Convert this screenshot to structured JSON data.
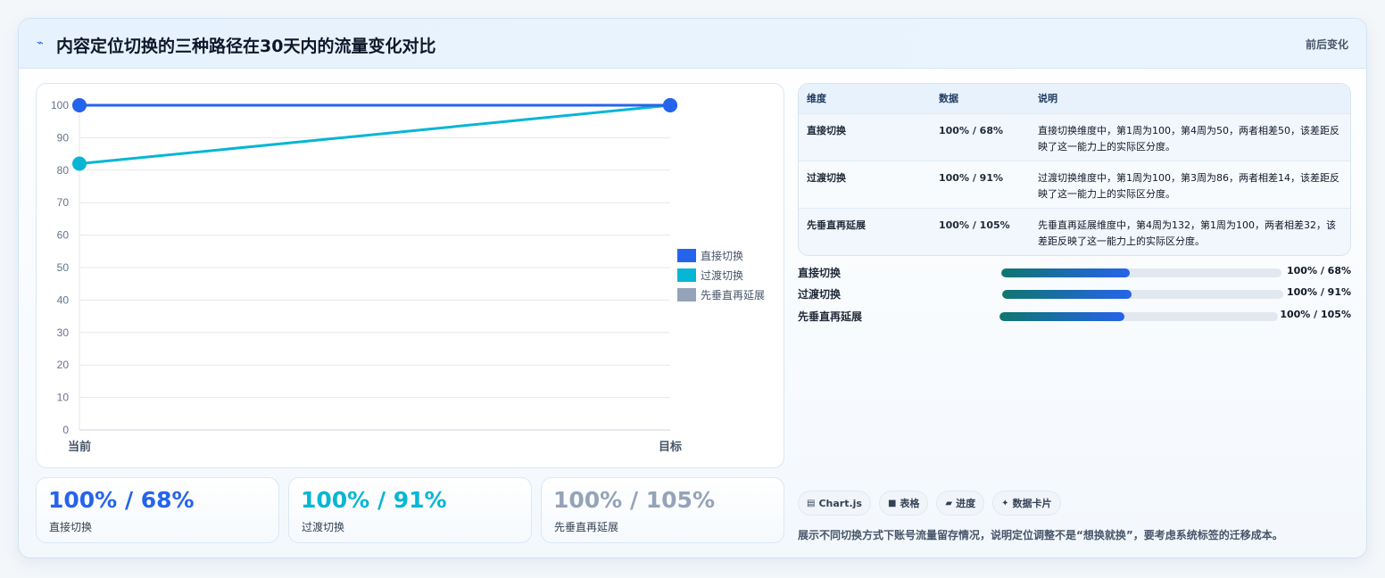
{
  "header": {
    "icon": "lightning-icon",
    "title": "内容定位切换的三种路径在30天内的流量变化对比",
    "tag": "前后变化"
  },
  "chart_data": {
    "type": "line",
    "categories": [
      "当前",
      "目标"
    ],
    "ylim": [
      0,
      100
    ],
    "yticks": [
      0,
      10,
      20,
      30,
      40,
      50,
      60,
      70,
      80,
      90,
      100
    ],
    "grid": true,
    "legend_position": "right",
    "series": [
      {
        "name": "直接切换",
        "values": [
          100,
          100
        ],
        "color": "#2563eb"
      },
      {
        "name": "过渡切换",
        "values": [
          82,
          100
        ],
        "color": "#06b6d4"
      },
      {
        "name": "先垂直再延展",
        "values": [
          100,
          100
        ],
        "color": "#94a3b8"
      }
    ]
  },
  "kpis": [
    {
      "value": "100% / 68%",
      "label": "直接切换",
      "color": "#2563eb"
    },
    {
      "value": "100% / 91%",
      "label": "过渡切换",
      "color": "#06b6d4"
    },
    {
      "value": "100% / 105%",
      "label": "先垂直再延展",
      "color": "#94a3b8"
    }
  ],
  "table": {
    "headers": [
      "维度",
      "数据",
      "说明"
    ],
    "rows": [
      {
        "dim": "直接切换",
        "data": "100% / 68%",
        "desc": "直接切换维度中，第1周为100，第4周为50，两者相差50，该差距反映了这一能力上的实际区分度。"
      },
      {
        "dim": "过渡切换",
        "data": "100% / 91%",
        "desc": "过渡切换维度中，第1周为100，第3周为86，两者相差14，该差距反映了这一能力上的实际区分度。"
      },
      {
        "dim": "先垂直再延展",
        "data": "100% / 105%",
        "desc": "先垂直再延展维度中，第4周为132，第1周为100，两者相差32，该差距反映了这一能力上的实际区分度。"
      }
    ]
  },
  "progress": [
    {
      "label": "直接切换",
      "value": "100% / 68%",
      "fraction": 0.46
    },
    {
      "label": "过渡切换",
      "value": "100% / 91%",
      "fraction": 0.46
    },
    {
      "label": "先垂直再延展",
      "value": "100% / 105%",
      "fraction": 0.45
    }
  ],
  "chips": [
    {
      "icon": "chart-icon",
      "glyph": "▤",
      "label": "Chart.js"
    },
    {
      "icon": "table-icon",
      "glyph": "■",
      "label": "表格"
    },
    {
      "icon": "progress-icon",
      "glyph": "▰",
      "label": "进度"
    },
    {
      "icon": "data-card-icon",
      "glyph": "✦",
      "label": "数据卡片"
    }
  ],
  "footnote": "展示不同切换方式下账号流量留存情况，说明定位调整不是“想换就换”，要考虑系统标签的迁移成本。"
}
